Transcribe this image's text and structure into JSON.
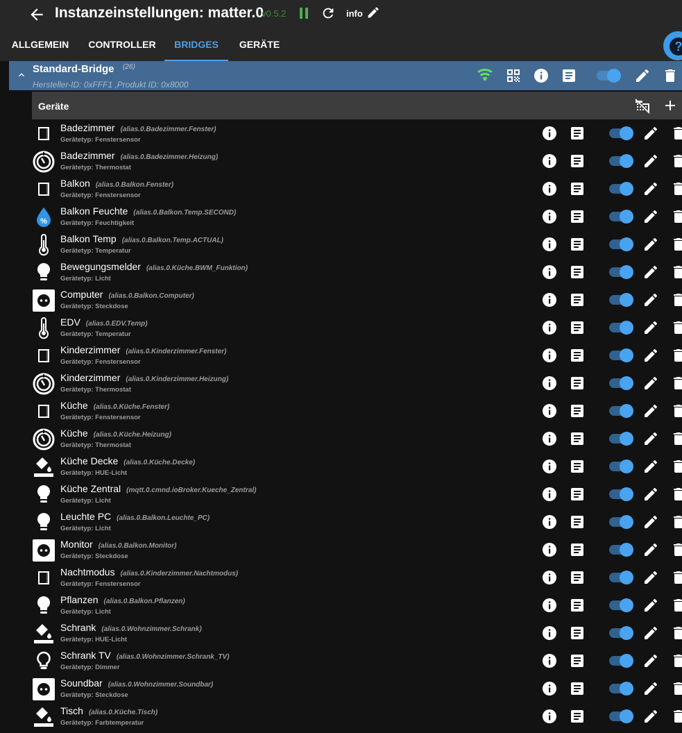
{
  "header": {
    "title": "Instanzeinstellungen: matter.0",
    "version": "v0.5.2",
    "info_label": "info"
  },
  "tabs": [
    {
      "label": "ALLGEMEIN"
    },
    {
      "label": "CONTROLLER"
    },
    {
      "label": "BRIDGES",
      "active": true
    },
    {
      "label": "GERÄTE"
    }
  ],
  "help_label": "?",
  "bridge": {
    "name": "Standard-Bridge",
    "count": "(26)",
    "ids": "Hersteller-ID: 0xFFF1  ,Produkt ID: 0x8000",
    "enabled": true
  },
  "devices_header": "Geräte",
  "colors": {
    "accent": "#4a9fe8",
    "bridge_bg": "#436a93",
    "wifi": "#5ee05e"
  },
  "devices": [
    {
      "name": "Badezimmer",
      "alias": "(alias.0.Badezimmer.Fenster)",
      "type": "Gerätetyp: Fenstersensor",
      "icon": "window-icon",
      "enabled": true
    },
    {
      "name": "Badezimmer",
      "alias": "(alias.0.Badezimmer.Heizung)",
      "type": "Gerätetyp: Thermostat",
      "icon": "thermostat-icon",
      "enabled": true
    },
    {
      "name": "Balkon",
      "alias": "(alias.0.Balkon.Fenster)",
      "type": "Gerätetyp: Fenstersensor",
      "icon": "window-icon",
      "enabled": true
    },
    {
      "name": "Balkon Feuchte",
      "alias": "(alias.0.Balkon.Temp.SECOND)",
      "type": "Gerätetyp: Feuchtigkeit",
      "icon": "humidity-icon",
      "enabled": true
    },
    {
      "name": "Balkon Temp",
      "alias": "(alias.0.Balkon.Temp.ACTUAL)",
      "type": "Gerätetyp: Temperatur",
      "icon": "thermometer-icon",
      "enabled": true
    },
    {
      "name": "Bewegungsmelder",
      "alias": "(alias.0.Küche.BWM_Funktion)",
      "type": "Gerätetyp: Licht",
      "icon": "bulb-icon",
      "enabled": true
    },
    {
      "name": "Computer",
      "alias": "(alias.0.Balkon.Computer)",
      "type": "Gerätetyp: Steckdose",
      "icon": "socket-icon",
      "enabled": true
    },
    {
      "name": "EDV",
      "alias": "(alias.0.EDV.Temp)",
      "type": "Gerätetyp: Temperatur",
      "icon": "thermometer-icon",
      "enabled": true
    },
    {
      "name": "Kinderzimmer",
      "alias": "(alias.0.Kinderzimmer.Fenster)",
      "type": "Gerätetyp: Fenstersensor",
      "icon": "window-icon",
      "enabled": true
    },
    {
      "name": "Kinderzimmer",
      "alias": "(alias.0.Kinderzimmer.Heizung)",
      "type": "Gerätetyp: Thermostat",
      "icon": "thermostat-icon",
      "enabled": true
    },
    {
      "name": "Küche",
      "alias": "(alias.0.Küche.Fenster)",
      "type": "Gerätetyp: Fenstersensor",
      "icon": "window-icon",
      "enabled": true
    },
    {
      "name": "Küche",
      "alias": "(alias.0.Küche.Heizung)",
      "type": "Gerätetyp: Thermostat",
      "icon": "thermostat-icon",
      "enabled": true
    },
    {
      "name": "Küche Decke",
      "alias": "(alias.0.Küche.Decke)",
      "type": "Gerätetyp: HUE-Licht",
      "icon": "paint-bucket-icon",
      "enabled": true
    },
    {
      "name": "Küche Zentral",
      "alias": "(mqtt.0.cmnd.ioBroker.Kueche_Zentral)",
      "type": "Gerätetyp: Licht",
      "icon": "bulb-icon",
      "enabled": true
    },
    {
      "name": "Leuchte PC",
      "alias": "(alias.0.Balkon.Leuchte_PC)",
      "type": "Gerätetyp: Licht",
      "icon": "bulb-icon",
      "enabled": true
    },
    {
      "name": "Monitor",
      "alias": "(alias.0.Balkon.Monitor)",
      "type": "Gerätetyp: Steckdose",
      "icon": "socket-icon",
      "enabled": true
    },
    {
      "name": "Nachtmodus",
      "alias": "(alias.0.Kinderzimmer.Nachtmodus)",
      "type": "Gerätetyp: Fenstersensor",
      "icon": "window-icon",
      "enabled": true
    },
    {
      "name": "Pflanzen",
      "alias": "(alias.0.Balkon.Pflanzen)",
      "type": "Gerätetyp: Licht",
      "icon": "bulb-icon",
      "enabled": true
    },
    {
      "name": "Schrank",
      "alias": "(alias.0.Wohnzimmer.Schrank)",
      "type": "Gerätetyp: HUE-Licht",
      "icon": "paint-bucket-icon",
      "enabled": true
    },
    {
      "name": "Schrank TV",
      "alias": "(alias.0.Wohnzimmer.Schrank_TV)",
      "type": "Gerätetyp: Dimmer",
      "icon": "bulb-outline-icon",
      "enabled": true
    },
    {
      "name": "Soundbar",
      "alias": "(alias.0.Wohnzimmer.Soundbar)",
      "type": "Gerätetyp: Steckdose",
      "icon": "socket-icon",
      "enabled": true
    },
    {
      "name": "Tisch",
      "alias": "(alias.0.Küche.Tisch)",
      "type": "Gerätetyp: Farbtemperatur",
      "icon": "paint-bucket-icon",
      "enabled": true
    }
  ]
}
